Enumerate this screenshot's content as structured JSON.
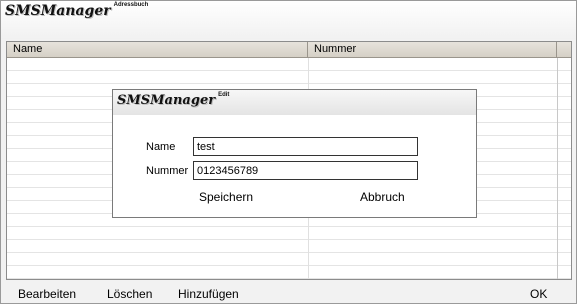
{
  "window": {
    "title": "SMSManager",
    "subtitle": "Adressbuch"
  },
  "table": {
    "columns": [
      "Name",
      "Nummer"
    ],
    "rows": []
  },
  "footer": {
    "edit_label": "Bearbeiten",
    "delete_label": "Löschen",
    "add_label": "Hinzufügen",
    "ok_label": "OK"
  },
  "dialog": {
    "title": "SMSManager",
    "subtitle": "Edit",
    "name_label": "Name",
    "name_value": "test",
    "number_label": "Nummer",
    "number_value": "0123456789",
    "save_label": "Speichern",
    "cancel_label": "Abbruch"
  }
}
